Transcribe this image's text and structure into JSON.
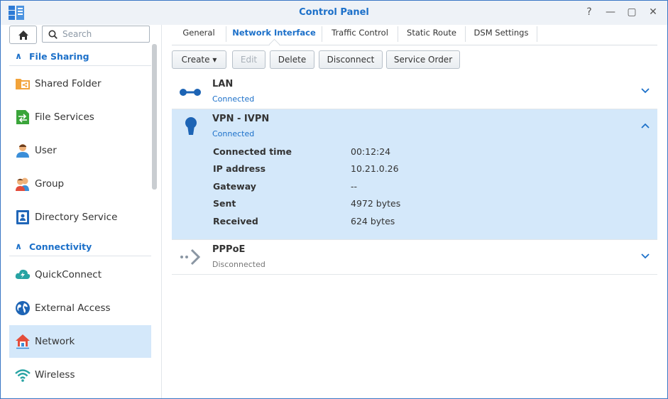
{
  "window": {
    "title": "Control Panel"
  },
  "search": {
    "placeholder": "Search"
  },
  "sidebar": {
    "sections": [
      {
        "label": "File Sharing"
      },
      {
        "label": "Connectivity"
      }
    ],
    "items": [
      {
        "label": "Shared Folder"
      },
      {
        "label": "File Services"
      },
      {
        "label": "User"
      },
      {
        "label": "Group"
      },
      {
        "label": "Directory Service"
      },
      {
        "label": "QuickConnect"
      },
      {
        "label": "External Access"
      },
      {
        "label": "Network"
      },
      {
        "label": "Wireless"
      }
    ]
  },
  "tabs": [
    {
      "label": "General"
    },
    {
      "label": "Network Interface"
    },
    {
      "label": "Traffic Control"
    },
    {
      "label": "Static Route"
    },
    {
      "label": "DSM Settings"
    }
  ],
  "toolbar": {
    "create": "Create ▾",
    "edit": "Edit",
    "delete": "Delete",
    "disconnect": "Disconnect",
    "service_order": "Service Order"
  },
  "interfaces": [
    {
      "name": "LAN",
      "status": "Connected"
    },
    {
      "name": "VPN - IVPN",
      "status": "Connected",
      "details": [
        {
          "key": "Connected time",
          "value": "00:12:24"
        },
        {
          "key": "IP address",
          "value": "10.21.0.26"
        },
        {
          "key": "Gateway",
          "value": "--"
        },
        {
          "key": "Sent",
          "value": "4972 bytes"
        },
        {
          "key": "Received",
          "value": "624 bytes"
        }
      ]
    },
    {
      "name": "PPPoE",
      "status": "Disconnected"
    }
  ],
  "colors": {
    "accent": "#1c70c9",
    "selected_bg": "#d4e8fa",
    "connected": "#1c70c9",
    "disconnected": "#777777"
  }
}
